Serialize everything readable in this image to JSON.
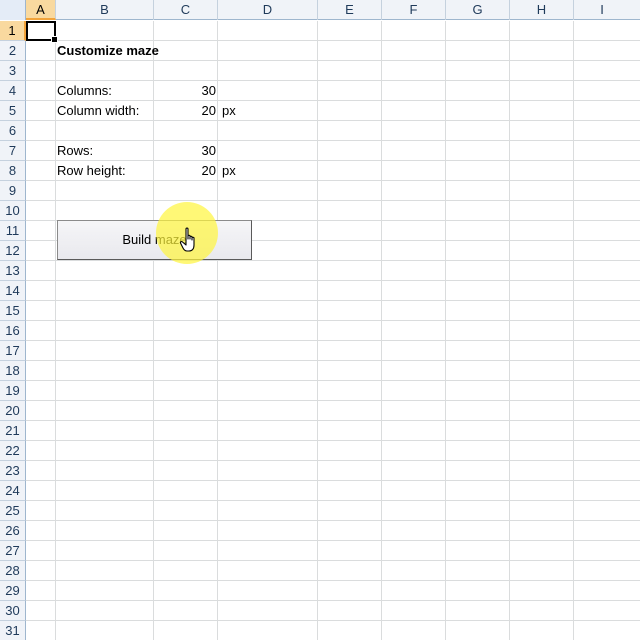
{
  "columns": [
    "A",
    "B",
    "C",
    "D",
    "E",
    "F",
    "G",
    "H",
    "I"
  ],
  "rows": [
    "1",
    "2",
    "3",
    "4",
    "5",
    "6",
    "7",
    "8",
    "9",
    "10",
    "11",
    "12",
    "13",
    "14",
    "15",
    "16",
    "17",
    "18",
    "19",
    "20",
    "21",
    "22",
    "23",
    "24",
    "25",
    "26",
    "27",
    "28",
    "29",
    "30",
    "31"
  ],
  "selected_column": "A",
  "selected_row": "1",
  "sheet": {
    "title": "Customize maze",
    "columns_label": "Columns:",
    "columns_value": "30",
    "column_width_label": "Column width:",
    "column_width_value": "20",
    "column_width_unit": "px",
    "rows_label": "Rows:",
    "rows_value": "30",
    "row_height_label": "Row height:",
    "row_height_value": "20",
    "row_height_unit": "px"
  },
  "button": {
    "label": "Build maze"
  },
  "icons": {
    "cursor": "hand-pointer-icon"
  },
  "colors": {
    "header_selected": "#f9d99f",
    "header_selected_accent": "#f2a33a",
    "highlight": "#fff53c"
  }
}
